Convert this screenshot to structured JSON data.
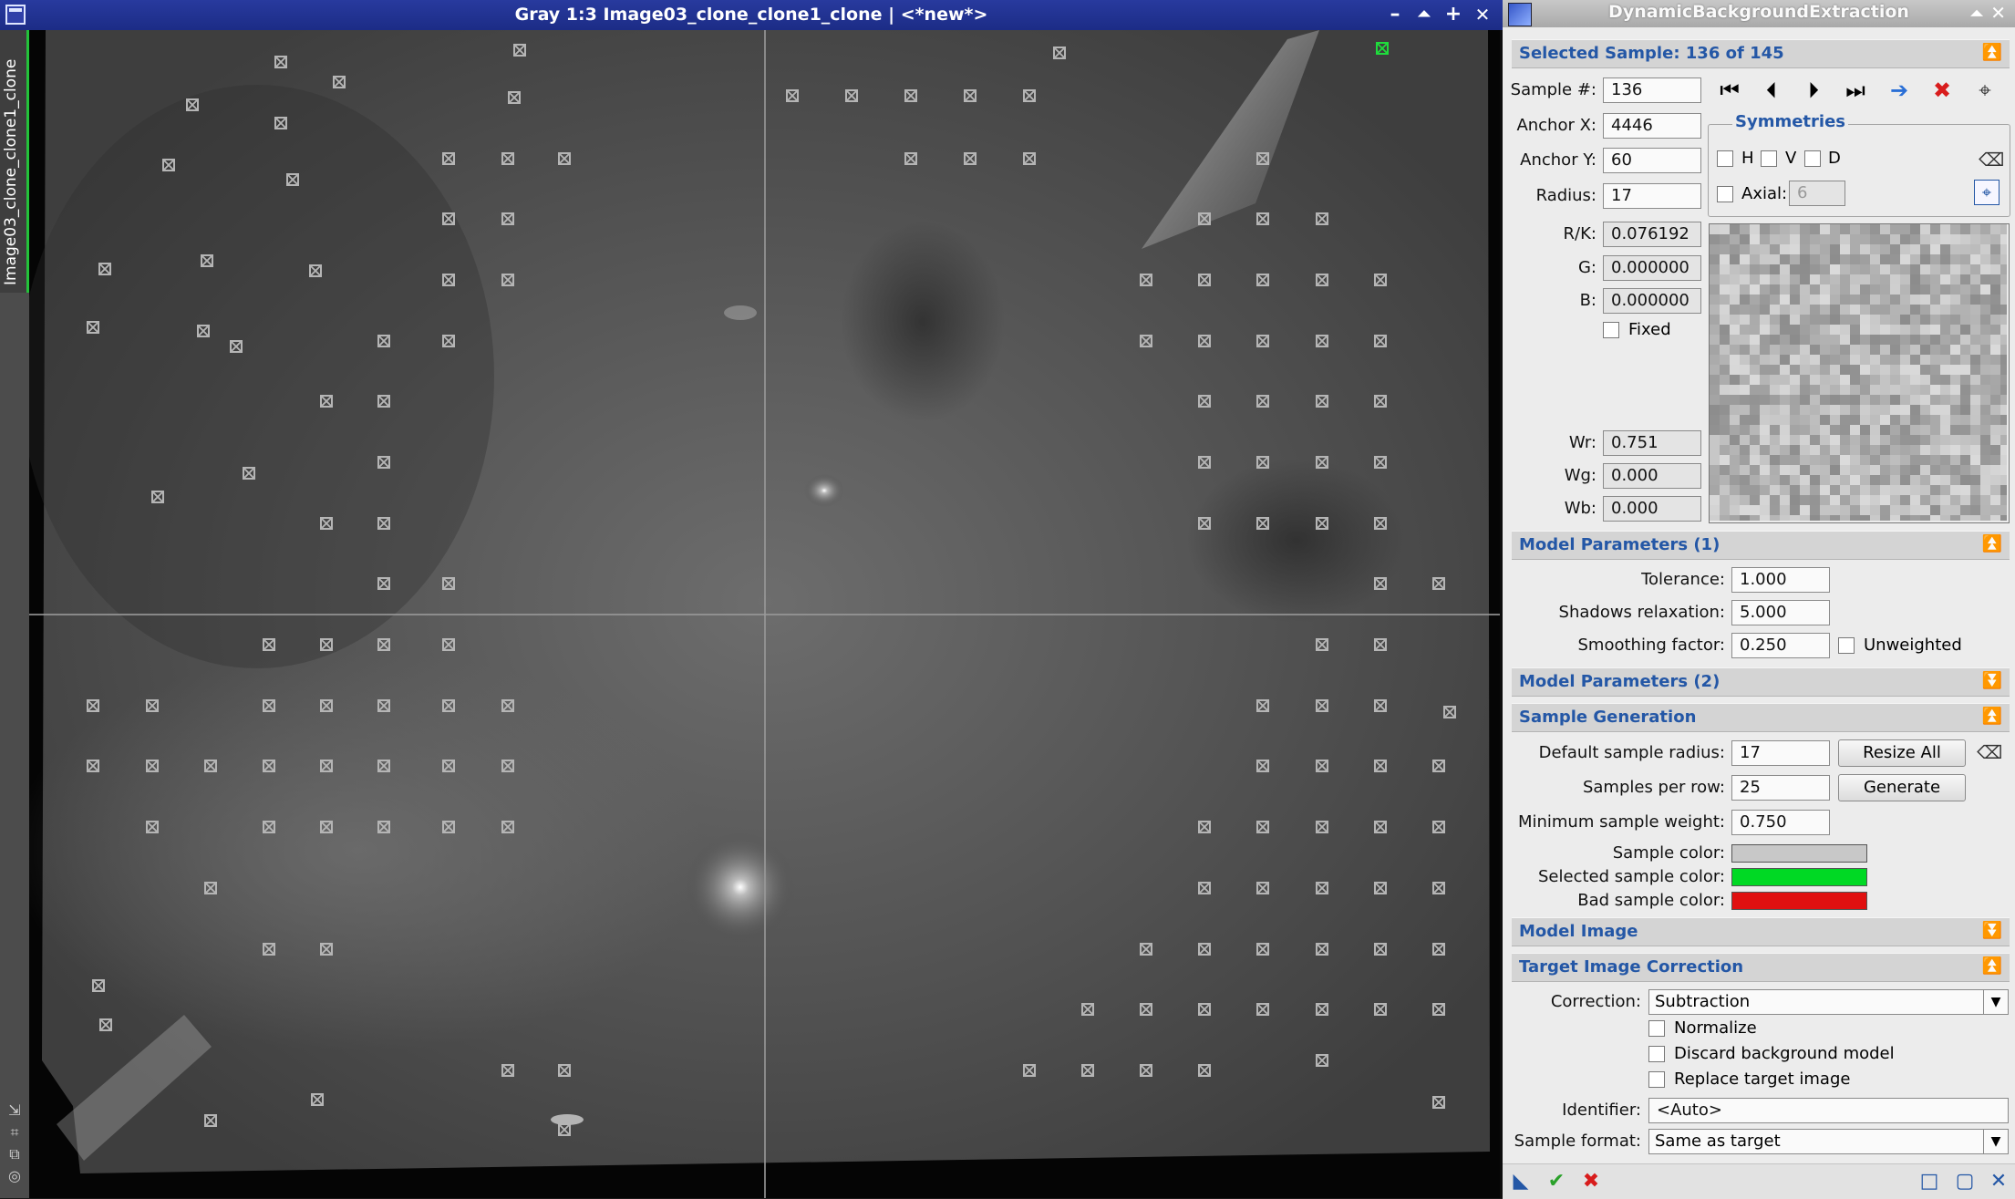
{
  "image_window": {
    "title": "Gray 1:3 Image03_clone_clone1_clone | <*new*>",
    "view_tab_label": "Image03_clone_clone1_clone",
    "buttons": {
      "minimize": "–",
      "shade": "⏶",
      "maximize": "+",
      "close": "✕"
    },
    "sidebar_icons": [
      "arrow-icon",
      "crop-icon",
      "copy-icon",
      "target-icon"
    ],
    "colors": {
      "sample": "#b5b5b5",
      "selected_sample": "#1fdc3c"
    }
  },
  "dbe": {
    "title": "DynamicBackgroundExtraction",
    "selected_sample": {
      "header": "Selected Sample: 136 of 145",
      "sample_label": "Sample #:",
      "sample_value": "136",
      "anchor_x_label": "Anchor X:",
      "anchor_x_value": "4446",
      "anchor_y_label": "Anchor Y:",
      "anchor_y_value": "60",
      "radius_label": "Radius:",
      "radius_value": "17",
      "rk_label": "R/K:",
      "rk_value": "0.076192",
      "g_label": "G:",
      "g_value": "0.000000",
      "b_label": "B:",
      "b_value": "0.000000",
      "fixed_label": "Fixed",
      "wr_label": "Wr:",
      "wr_value": "0.751",
      "wg_label": "Wg:",
      "wg_value": "0.000",
      "wb_label": "Wb:",
      "wb_value": "0.000",
      "symmetries_label": "Symmetries",
      "h_label": "H",
      "v_label": "V",
      "d_label": "D",
      "axial_label": "Axial:",
      "axial_value": "6"
    },
    "model_params_1": {
      "header": "Model Parameters (1)",
      "tolerance_label": "Tolerance:",
      "tolerance_value": "1.000",
      "shadows_label": "Shadows relaxation:",
      "shadows_value": "5.000",
      "smoothing_label": "Smoothing factor:",
      "smoothing_value": "0.250",
      "unweighted_label": "Unweighted"
    },
    "model_params_2": {
      "header": "Model Parameters (2)"
    },
    "sample_generation": {
      "header": "Sample Generation",
      "default_radius_label": "Default sample radius:",
      "default_radius_value": "17",
      "resize_all_label": "Resize All",
      "per_row_label": "Samples per row:",
      "per_row_value": "25",
      "generate_label": "Generate",
      "min_weight_label": "Minimum sample weight:",
      "min_weight_value": "0.750",
      "sample_color_label": "Sample color:",
      "sample_color": "#c8c8c8",
      "selected_color_label": "Selected sample color:",
      "selected_color": "#00d924",
      "bad_color_label": "Bad sample color:",
      "bad_color": "#e01010"
    },
    "model_image": {
      "header": "Model Image"
    },
    "target_correction": {
      "header": "Target Image Correction",
      "correction_label": "Correction:",
      "correction_value": "Subtraction",
      "normalize_label": "Normalize",
      "discard_label": "Discard background model",
      "replace_label": "Replace target image",
      "identifier_label": "Identifier:",
      "identifier_value": "<Auto>",
      "format_label": "Sample format:",
      "format_value": "Same as target"
    },
    "toggle_icons": {
      "collapse": "⏫",
      "expand": "⏬"
    },
    "nav_icons": {
      "first": "⏮",
      "prev": "⏴",
      "next": "⏵",
      "last": "⏭",
      "goto": "➔",
      "delete": "✖",
      "target": "⌖"
    },
    "bottom_icons": {
      "new_instance": "◣",
      "apply": "✔",
      "cancel": "✖",
      "browse": "□",
      "script": "▢",
      "reset": "✕"
    }
  }
}
